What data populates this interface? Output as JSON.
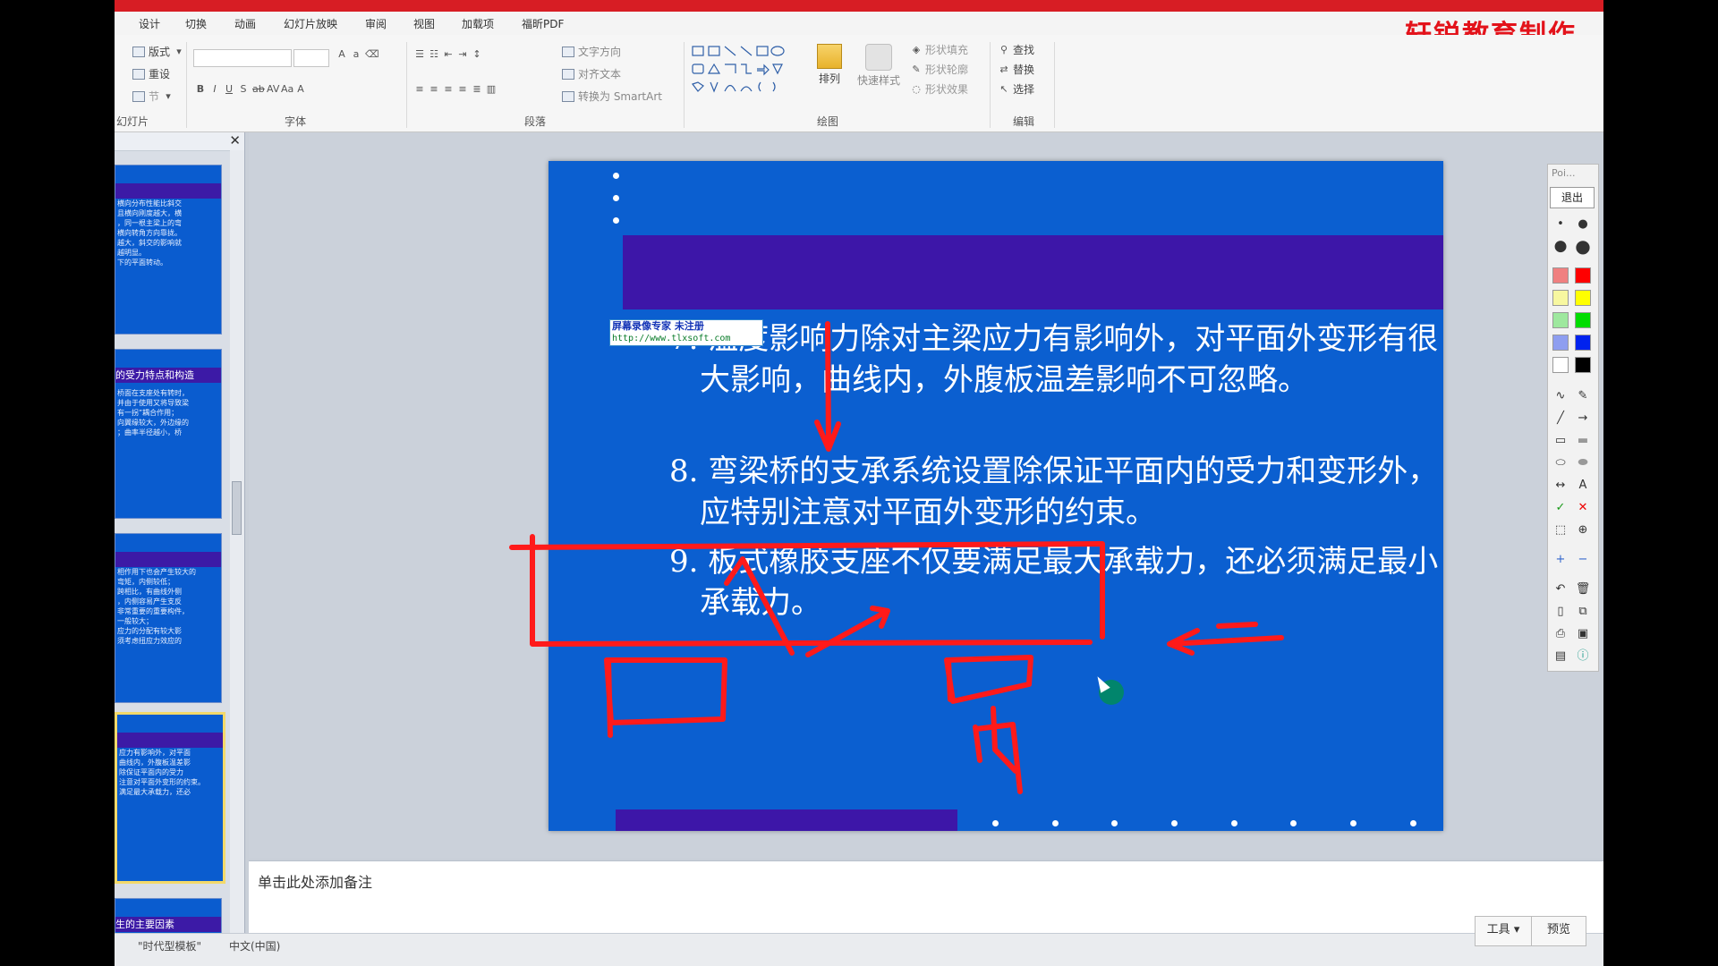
{
  "brand": {
    "text": "轩锐教育制作",
    "color": "#e3131b"
  },
  "ribbon_tabs": [
    "设计",
    "切换",
    "动画",
    "幻灯片放映",
    "审阅",
    "视图",
    "加载项",
    "福昕PDF"
  ],
  "ribbon": {
    "slides_group": {
      "label": "幻灯片",
      "layout": "版式",
      "reset": "重设",
      "section": "节"
    },
    "font_group": {
      "label": "字体"
    },
    "paragraph_group": {
      "label": "段落",
      "text_direction": "文字方向",
      "align_text": "对齐文本",
      "smartart": "转换为 SmartArt"
    },
    "drawing_group": {
      "label": "绘图",
      "arrange": "排列",
      "quick_styles": "快速样式",
      "shape_fill": "形状填充",
      "shape_outline": "形状轮廓",
      "shape_effects": "形状效果"
    },
    "editing_group": {
      "label": "编辑",
      "find": "查找",
      "replace": "替换",
      "select": "选择"
    }
  },
  "thumbnails": [
    {
      "band": "",
      "lines": [
        "横向分布性能比斜交",
        "且横向刚度越大，横",
        "",
        "，同一根主梁上的弯",
        "横向转角方向靠拢。",
        "",
        "越大，斜交的影响就",
        "越明显。",
        "下的平面转动。"
      ]
    },
    {
      "band": "的受力特点和构造",
      "lines": [
        "桥面在支座处有转时，",
        "并由于使用又将导致梁",
        "有一拐”耦合作用；",
        "向翼缘较大，外边缘的",
        "；曲率半径越小，桥"
      ]
    },
    {
      "band": "",
      "lines": [
        "相作用下也会产生较大的",
        "弯矩，内侧较低；",
        "跨相比，有曲线外侧",
        "，内侧容易产生支反",
        "",
        "非常重要的重要构件，",
        "一般较大；",
        "应力的分配有较大影",
        "须考虑扭应力效应的"
      ]
    },
    {
      "band": "",
      "active": true,
      "lines": [
        "",
        "应力有影响外，对平面",
        "曲线内，外腹板温差影",
        "",
        "除保证平面内的受力",
        "注意对平面外变形的约束。",
        "满足最大承载力，还必"
      ]
    },
    {
      "band": "生的主要因素",
      "lines": []
    }
  ],
  "slide": {
    "items": [
      {
        "text": "7. 温度影响力除对主梁应力有影响外，对平面外变形有很大影响，曲线内，外腹板温差影响不可忽略。"
      },
      {
        "text": "8. 弯梁桥的支承系统设置除保证平面内的受力和变形外，应特别注意对平面外变形的约束。"
      },
      {
        "text": "9. 板式橡胶支座不仅要满足最大承载力，还必须满足最小承载力。"
      }
    ],
    "handwriting": "内",
    "watermark": {
      "line1": "屏幕录像专家      未注册",
      "line2": "http://www.tlxsoft.com"
    },
    "colors": {
      "background": "#0b5fd0",
      "band": "#3d16a8",
      "ink": "#ff1a1a"
    }
  },
  "notes_placeholder": "单击此处添加备注",
  "status": {
    "template": "\"时代型模板\"",
    "language": "中文(中国)",
    "tools_button": "工具",
    "preview_button": "预览"
  },
  "pen_tools": {
    "title": "Poi...",
    "exit_button": "退出"
  }
}
